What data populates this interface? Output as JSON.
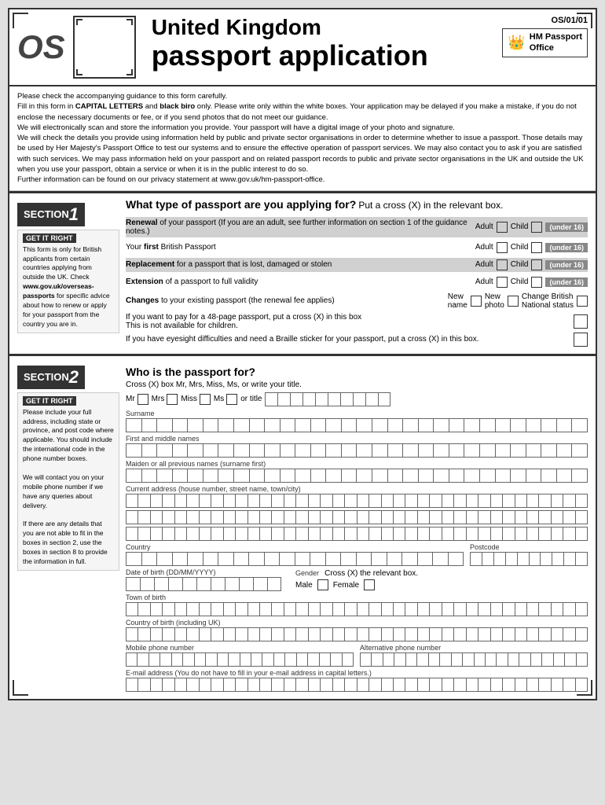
{
  "page": {
    "form_number": "OS/01/01",
    "os_logo": "OS",
    "title_line1": "United Kingdom",
    "title_line2": "passport application",
    "hm_passport": "HM Passport\nOffice",
    "info_text": "Please check the accompanying guidance to this form carefully.\nFill in this form in CAPITAL LETTERS and black biro only. Please write only within the white boxes. Your application may be delayed if you make a mistake, if you do not enclose the necessary documents or fee, or if you send photos that do not meet our guidance.\nWe will electronically scan and store the information you provide. Your passport will have a digital image of your photo and signature.\nWe will check the details you provide using information held by public and private sector organisations in order to determine whether to issue a passport. Those details may be used by Her Majesty's Passport Office to test our systems and to ensure the effective operation of passport services. We may also contact you to ask if you are satisfied with such services. We may pass information held on your passport and on related passport records to public and private sector organisations in the UK and outside the UK when you use your passport, obtain a service or when it is in the public interest to do so.\nFurther information can be found on our privacy statement at www.gov.uk/hm-passport-office."
  },
  "section1": {
    "label": "SECTION",
    "number": "1",
    "question": "What type of passport are you applying for?",
    "instruction": "Put a cross (X) in the relevant box.",
    "sidebar": {
      "title": "GET IT RIGHT",
      "text": "This form is only for British applicants from certain countries applying from outside the UK. Check www.gov.uk/overseas-passports for specific advice about how to renew or apply for your passport from the country you are in."
    },
    "rows": [
      {
        "label_bold": "Renewal",
        "label_rest": " of your passport (If you are an adult, see further information on section 1 of the guidance notes.)",
        "adult": "Adult",
        "child": "Child",
        "under16": "(under 16)",
        "shaded": true
      },
      {
        "label_bold": "Your first",
        "label_rest": " British Passport",
        "adult": "Adult",
        "child": "Child",
        "under16": "(under 16)",
        "shaded": false
      },
      {
        "label_bold": "Replacement",
        "label_rest": " for a passport that is lost, damaged or stolen",
        "adult": "Adult",
        "child": "Child",
        "under16": "(under 16)",
        "shaded": true
      },
      {
        "label_bold": "Extension",
        "label_rest": " of a passport to full validity",
        "adult": "Adult",
        "child": "Child",
        "under16": "(under 16)",
        "shaded": false
      }
    ],
    "changes_bold": "Changes",
    "changes_rest": " to your existing passport (the renewal fee applies)",
    "changes_options": [
      "New name",
      "New photo",
      "Change British National status"
    ],
    "page48_text": "If you want to pay for a 48-page passport, put a cross (X) in this box\nThis is not available for children.",
    "braille_text": "If you have eyesight difficulties and need a Braille sticker for your passport, put a cross (X) in this box."
  },
  "section2": {
    "label": "SECTION",
    "number": "2",
    "who_header": "Who is the passport for?",
    "cross_instruction": "Cross (X) box Mr, Mrs, Miss, Ms, or write your title.",
    "sidebar": {
      "title": "GET IT RIGHT",
      "text": "Please include your full address, including state or province, and post code where applicable. You should include the international code in the phone number boxes.\n\nWe will contact you on your mobile phone number if we have any queries about delivery.\n\nIf there are any details that you are not able to fit in the boxes in section 2, use the boxes in section 8 to provide the information in full."
    },
    "titles": [
      "Mr",
      "Mrs",
      "Miss",
      "Ms",
      "or title"
    ],
    "fields": {
      "surname": "Surname",
      "first_middle": "First and middle names",
      "maiden": "Maiden or all previous names (surname first)",
      "address": "Current address (house number, street name, town/city)",
      "country": "Country",
      "postcode": "Postcode",
      "dob": "Date of birth (DD/MM/YYYY)",
      "gender_label": "Gender",
      "gender_instruction": "Cross (X) the relevant box.",
      "male": "Male",
      "female": "Female",
      "town_of_birth": "Town of birth",
      "country_of_birth": "Country of birth (including UK)",
      "mobile": "Mobile phone number",
      "alt_phone": "Alternative phone number",
      "email_label": "E-mail address (You do not have to fill in your e-mail address in capital letters.)"
    },
    "num_boxes": {
      "surname": 30,
      "first_middle": 30,
      "maiden": 30,
      "address_row1": 40,
      "address_row2": 40,
      "country": 25,
      "postcode": 10,
      "dob": 10,
      "town": 30,
      "country_birth": 30,
      "phone": 18,
      "alt_phone": 18,
      "email": 40
    }
  }
}
